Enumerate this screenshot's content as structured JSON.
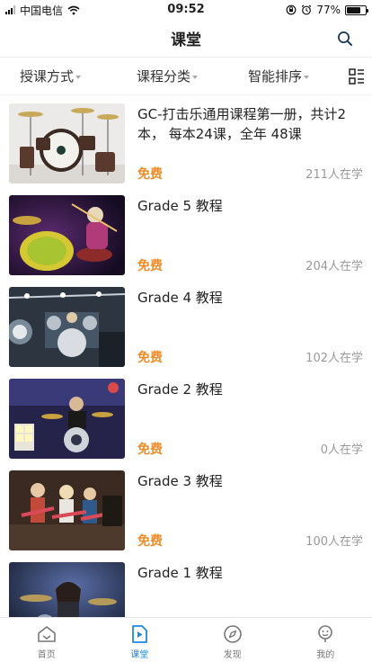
{
  "status_bar": {
    "carrier": "中国电信",
    "time": "09:52",
    "battery": "77%",
    "battery_level": 0.77
  },
  "nav": {
    "title": "课堂",
    "search_icon": "search-icon"
  },
  "filters": [
    {
      "label": "授课方式"
    },
    {
      "label": "课程分类"
    },
    {
      "label": "智能排序"
    }
  ],
  "courses": [
    {
      "title": "GC-打击乐通用课程第一册，共计2本， 每本24课，全年 48课",
      "price": "免费",
      "learners": "211人在学"
    },
    {
      "title": "Grade 5 教程",
      "price": "免费",
      "learners": "204人在学"
    },
    {
      "title": "Grade 4 教程",
      "price": "免费",
      "learners": "102人在学"
    },
    {
      "title": "Grade 2 教程",
      "price": "免费",
      "learners": "0人在学"
    },
    {
      "title": "Grade 3 教程",
      "price": "免费",
      "learners": "100人在学"
    },
    {
      "title": "Grade 1 教程",
      "price": "",
      "learners": ""
    }
  ],
  "tabs": [
    {
      "label": "首页",
      "icon": "home-icon"
    },
    {
      "label": "课堂",
      "icon": "play-icon"
    },
    {
      "label": "发现",
      "icon": "compass-icon"
    },
    {
      "label": "我的",
      "icon": "profile-icon"
    }
  ],
  "colors": {
    "accent": "#1e88e5",
    "price": "#f08a24"
  }
}
